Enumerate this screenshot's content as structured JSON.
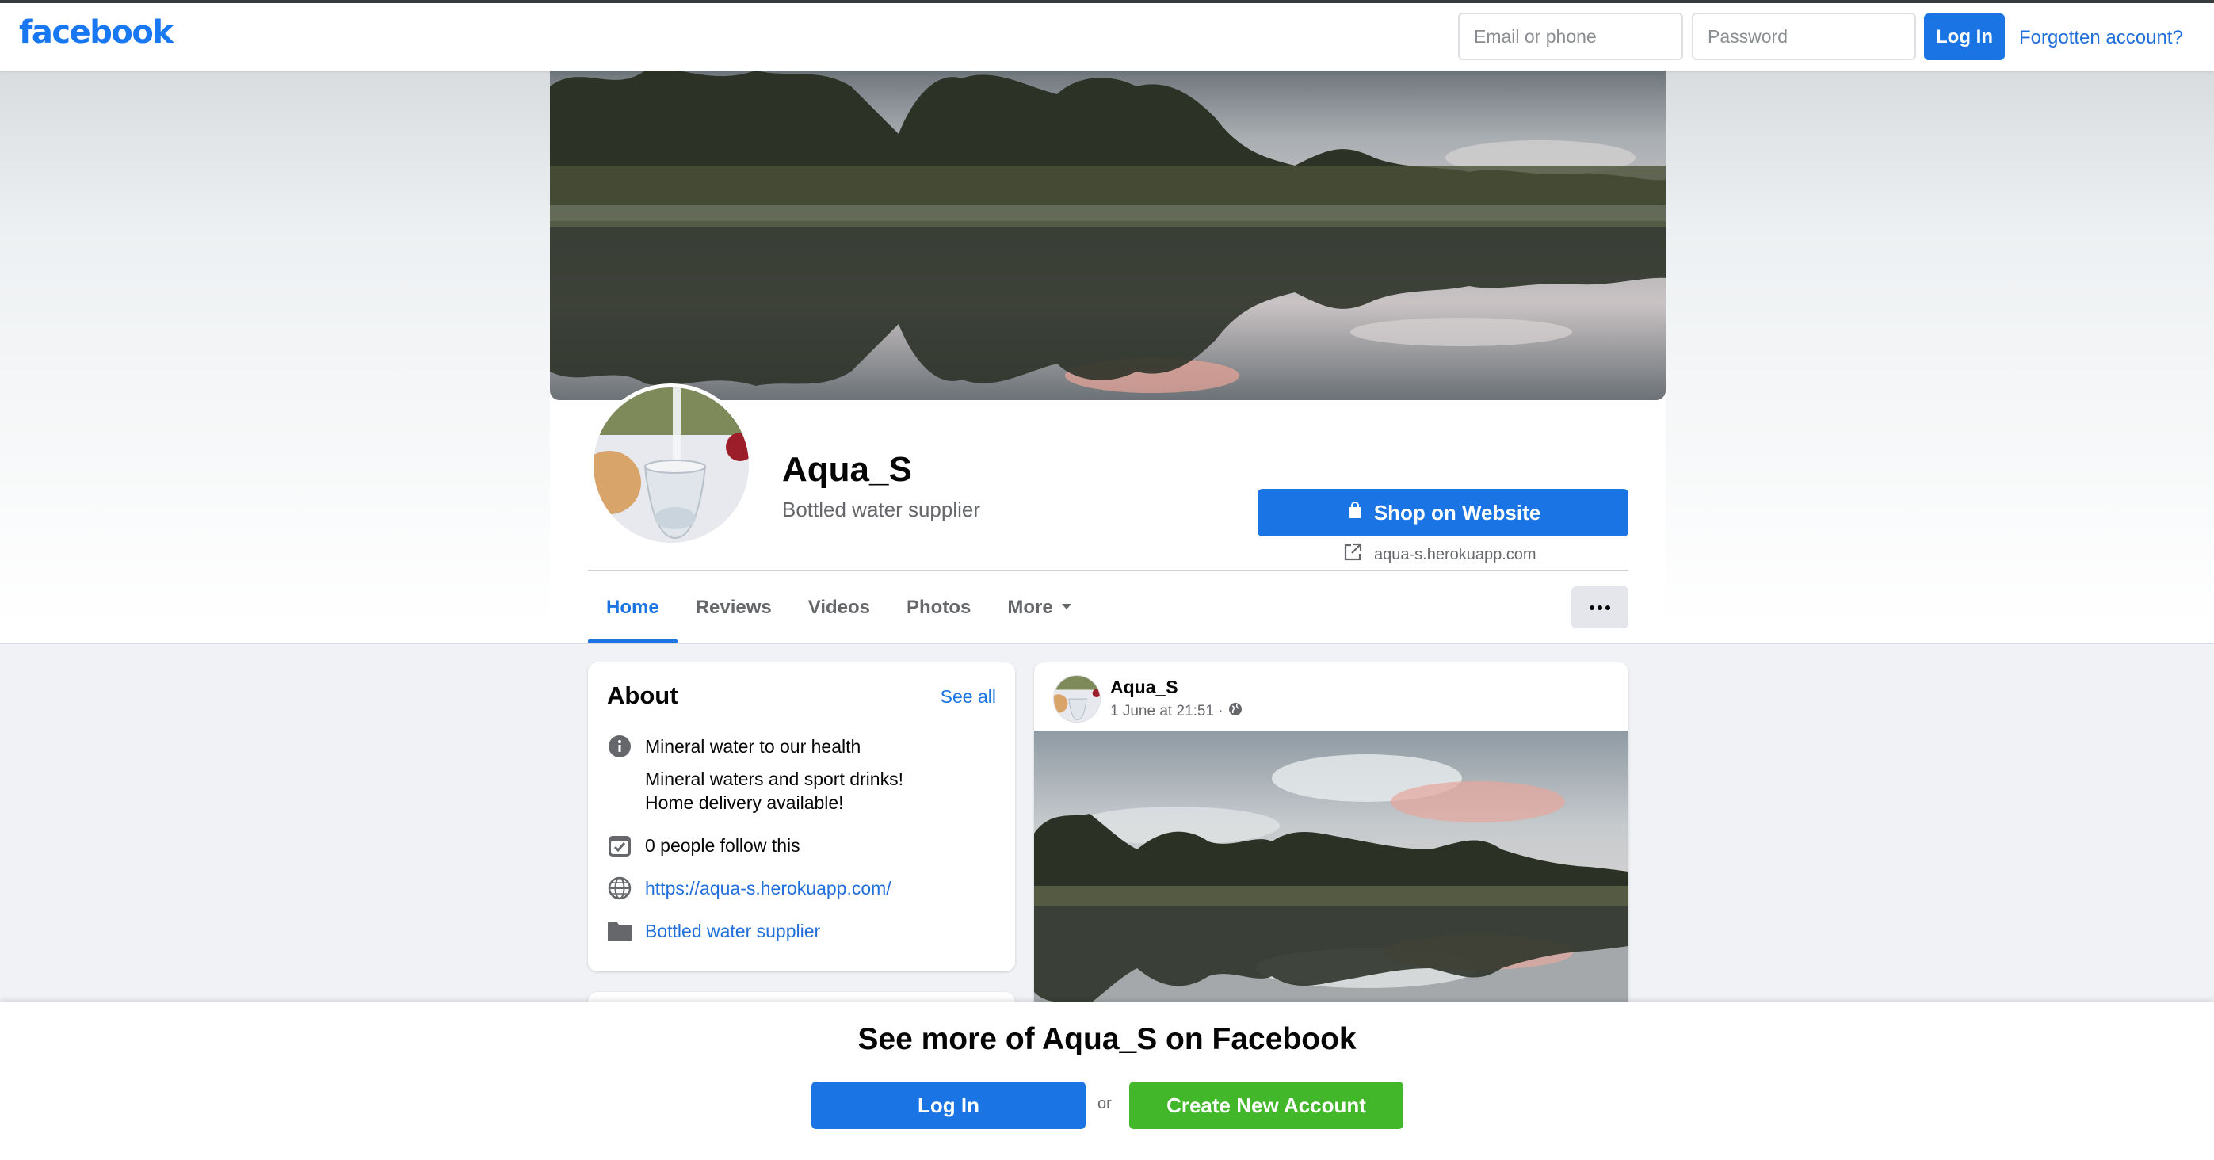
{
  "topbar": {
    "logo": "facebook",
    "email_placeholder": "Email or phone",
    "password_placeholder": "Password",
    "login_label": "Log In",
    "forgot_label": "Forgotten account?"
  },
  "profile": {
    "name": "Aqua_S",
    "category": "Bottled water supplier",
    "shop_button_label": "Shop on Website",
    "website_display": "aqua-s.herokuapp.com"
  },
  "tabs": [
    {
      "label": "Home",
      "active": true
    },
    {
      "label": "Reviews",
      "active": false
    },
    {
      "label": "Videos",
      "active": false
    },
    {
      "label": "Photos",
      "active": false
    },
    {
      "label": "More",
      "active": false
    }
  ],
  "about": {
    "title": "About",
    "see_all": "See all",
    "intro": "Mineral water to our health",
    "description_line1": "Mineral waters and sport drinks!",
    "description_line2": "Home delivery available!",
    "followers": "0 people follow this",
    "website": "https://aqua-s.herokuapp.com/",
    "category": "Bottled water supplier"
  },
  "post": {
    "author": "Aqua_S",
    "time": "1 June at 21:51 ·"
  },
  "banner": {
    "title": "See more of Aqua_S on Facebook",
    "login_label": "Log In",
    "or_label": "or",
    "create_label": "Create New Account"
  },
  "colors": {
    "brand_blue": "#1b74e4",
    "create_green": "#42b72a",
    "link_blue": "#216fdb",
    "secondary_text": "#65676b"
  },
  "icons": [
    "info-icon",
    "follow-check-icon",
    "globe-icon",
    "folder-icon",
    "shopping-bag-icon",
    "external-link-icon",
    "caret-down-icon",
    "more-dots-icon",
    "public-globe-icon"
  ]
}
